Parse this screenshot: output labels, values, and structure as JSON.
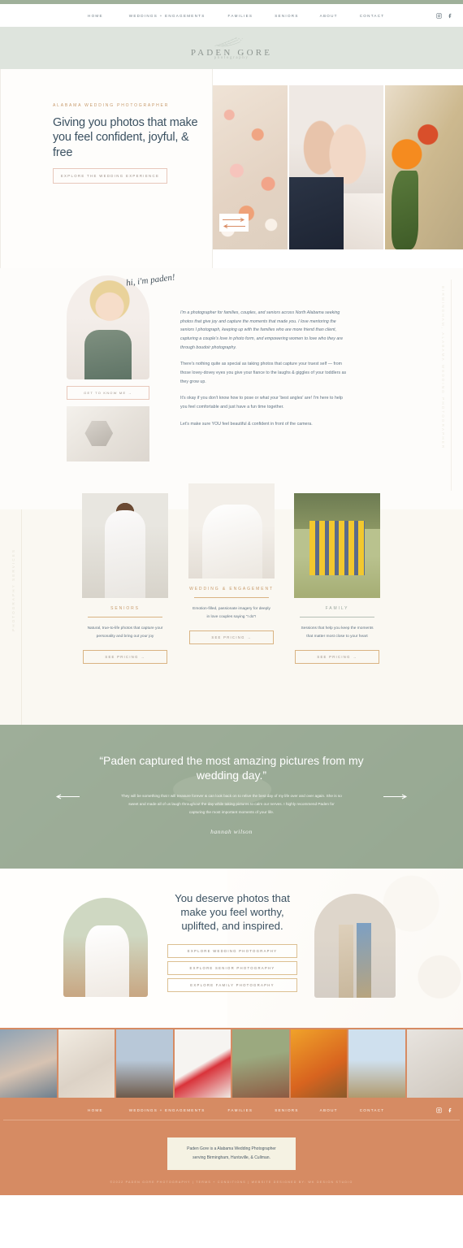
{
  "brand": {
    "name": "PADEN GORE",
    "tagline": "photography",
    "accent_gold": "#c79a6b",
    "accent_navy": "#3b5161",
    "accent_sage": "#9aab96",
    "accent_terracotta": "#d68b63",
    "accent_blush": "#e8c8bb"
  },
  "nav": {
    "items": [
      {
        "label": "HOME"
      },
      {
        "label": "WEDDINGS + ENGAGEMENTS"
      },
      {
        "label": "FAMILIES"
      },
      {
        "label": "SENIORS"
      },
      {
        "label": "ABOUT"
      },
      {
        "label": "CONTACT"
      }
    ],
    "social": [
      {
        "name": "instagram-icon"
      },
      {
        "name": "facebook-icon"
      }
    ]
  },
  "hero": {
    "eyebrow": "ALABAMA WEDDING PHOTOGRAPHER",
    "title": "Giving you photos that make you feel confident, joyful, & free",
    "cta": "EXPLORE THE WEDDING EXPERIENCE",
    "slides": [
      {
        "alt": "rose petals flat lay"
      },
      {
        "alt": "bride and groom foreheads together"
      },
      {
        "alt": "orange roses bouquet detail"
      }
    ],
    "nav_prev": "previous-slide",
    "nav_next": "next-slide"
  },
  "about": {
    "script": "hi, i'm paden!",
    "paragraphs": [
      "I'm a photographer for families, couples, and seniors across North Alabama seeking photos that give joy and capture the moments that made you. I love mentoring the seniors I photograph, keeping up with the families who are more friend than client, capturing a couple's love in photo form, and empowering women to love who they are through boudoir photography.",
      "There's nothing quite as special as taking photos that capture your truest self — from those lovey-dovey eyes you give your fiance to the laughs & giggles of your toddlers as they grow up.",
      "It's okay if you don't know how to pose or what your 'best angles' are! I'm here to help you feel comfortable and just have a fun time together.",
      "Let's make sure YOU feel beautiful & confident in front of the camera."
    ],
    "cta": "GET TO KNOW ME →",
    "vertical_label": "BIRMINGHAM, ALABAMA WEDDING PHOTOGRAPHER",
    "portrait_alt": "paden in denim jacket",
    "ring_alt": "engagement ring in box"
  },
  "services": {
    "vertical_label": "PHOTOGRAPHY SERVICES",
    "cards": [
      {
        "title": "SENIORS",
        "desc": "Natural, true-to-life photos that capture your personality and bring out your joy",
        "cta": "SEE PRICING →",
        "image_alt": "senior girl in white dress"
      },
      {
        "title": "WEDDING & ENGAGEMENT",
        "desc": "Emotion-filled, passionate imagery for deeply in love couples saying \"I do\"!",
        "cta": "SEE PRICING →",
        "image_alt": "bride and groom kissing under veil"
      },
      {
        "title": "FAMILY",
        "desc": "Sessions that help you keep the moments that matter most close to your heart",
        "cta": "SEE PRICING →",
        "image_alt": "family in yellow shirts outdoors"
      }
    ]
  },
  "testimonial": {
    "quote": "“Paden captured the most amazing pictures from my wedding day.”",
    "body": "They will be something that I will treasure forever & can look back on to relive the best day of my life over and over again. She is so sweet and made all of us laugh throughout the day while taking pictures to calm our nerves. I highly recommend Paden for capturing the most important moments of your life.",
    "signature": "hannah wilson",
    "prev": "previous-testimonial",
    "next": "next-testimonial"
  },
  "deserve": {
    "title": "You deserve photos that make you feel worthy, uplifted, and inspired.",
    "buttons": [
      {
        "label": "EXPLORE WEDDING PHOTOGRAPHY"
      },
      {
        "label": "EXPLORE SENIOR PHOTOGRAPHY"
      },
      {
        "label": "EXPLORE FAMILY PHOTOGRAPHY"
      }
    ],
    "left_image_alt": "bride with veil on campus",
    "right_image_alt": "couple walking holding hands"
  },
  "gallery": {
    "items": [
      {
        "alt": "couple embracing"
      },
      {
        "alt": "wedding invitation flat lay"
      },
      {
        "alt": "couple in city"
      },
      {
        "alt": "red bouquet on bed"
      },
      {
        "alt": "senior by brick wall"
      },
      {
        "alt": "orange floral arrangement"
      },
      {
        "alt": "bride and groom under arbor"
      },
      {
        "alt": "bridal shoes and florals"
      }
    ]
  },
  "footer": {
    "box_lines": [
      "Paden Gore is a Alabama Wedding Photographer",
      "serving Birmingham, Huntsville, & Cullman."
    ],
    "copyright": "©2022 PADEN GORE PHOTOGRAPHY | TERMS + CONDITIONS | WEBSITE DESIGNED BY: WK DESIGN STUDIO"
  }
}
